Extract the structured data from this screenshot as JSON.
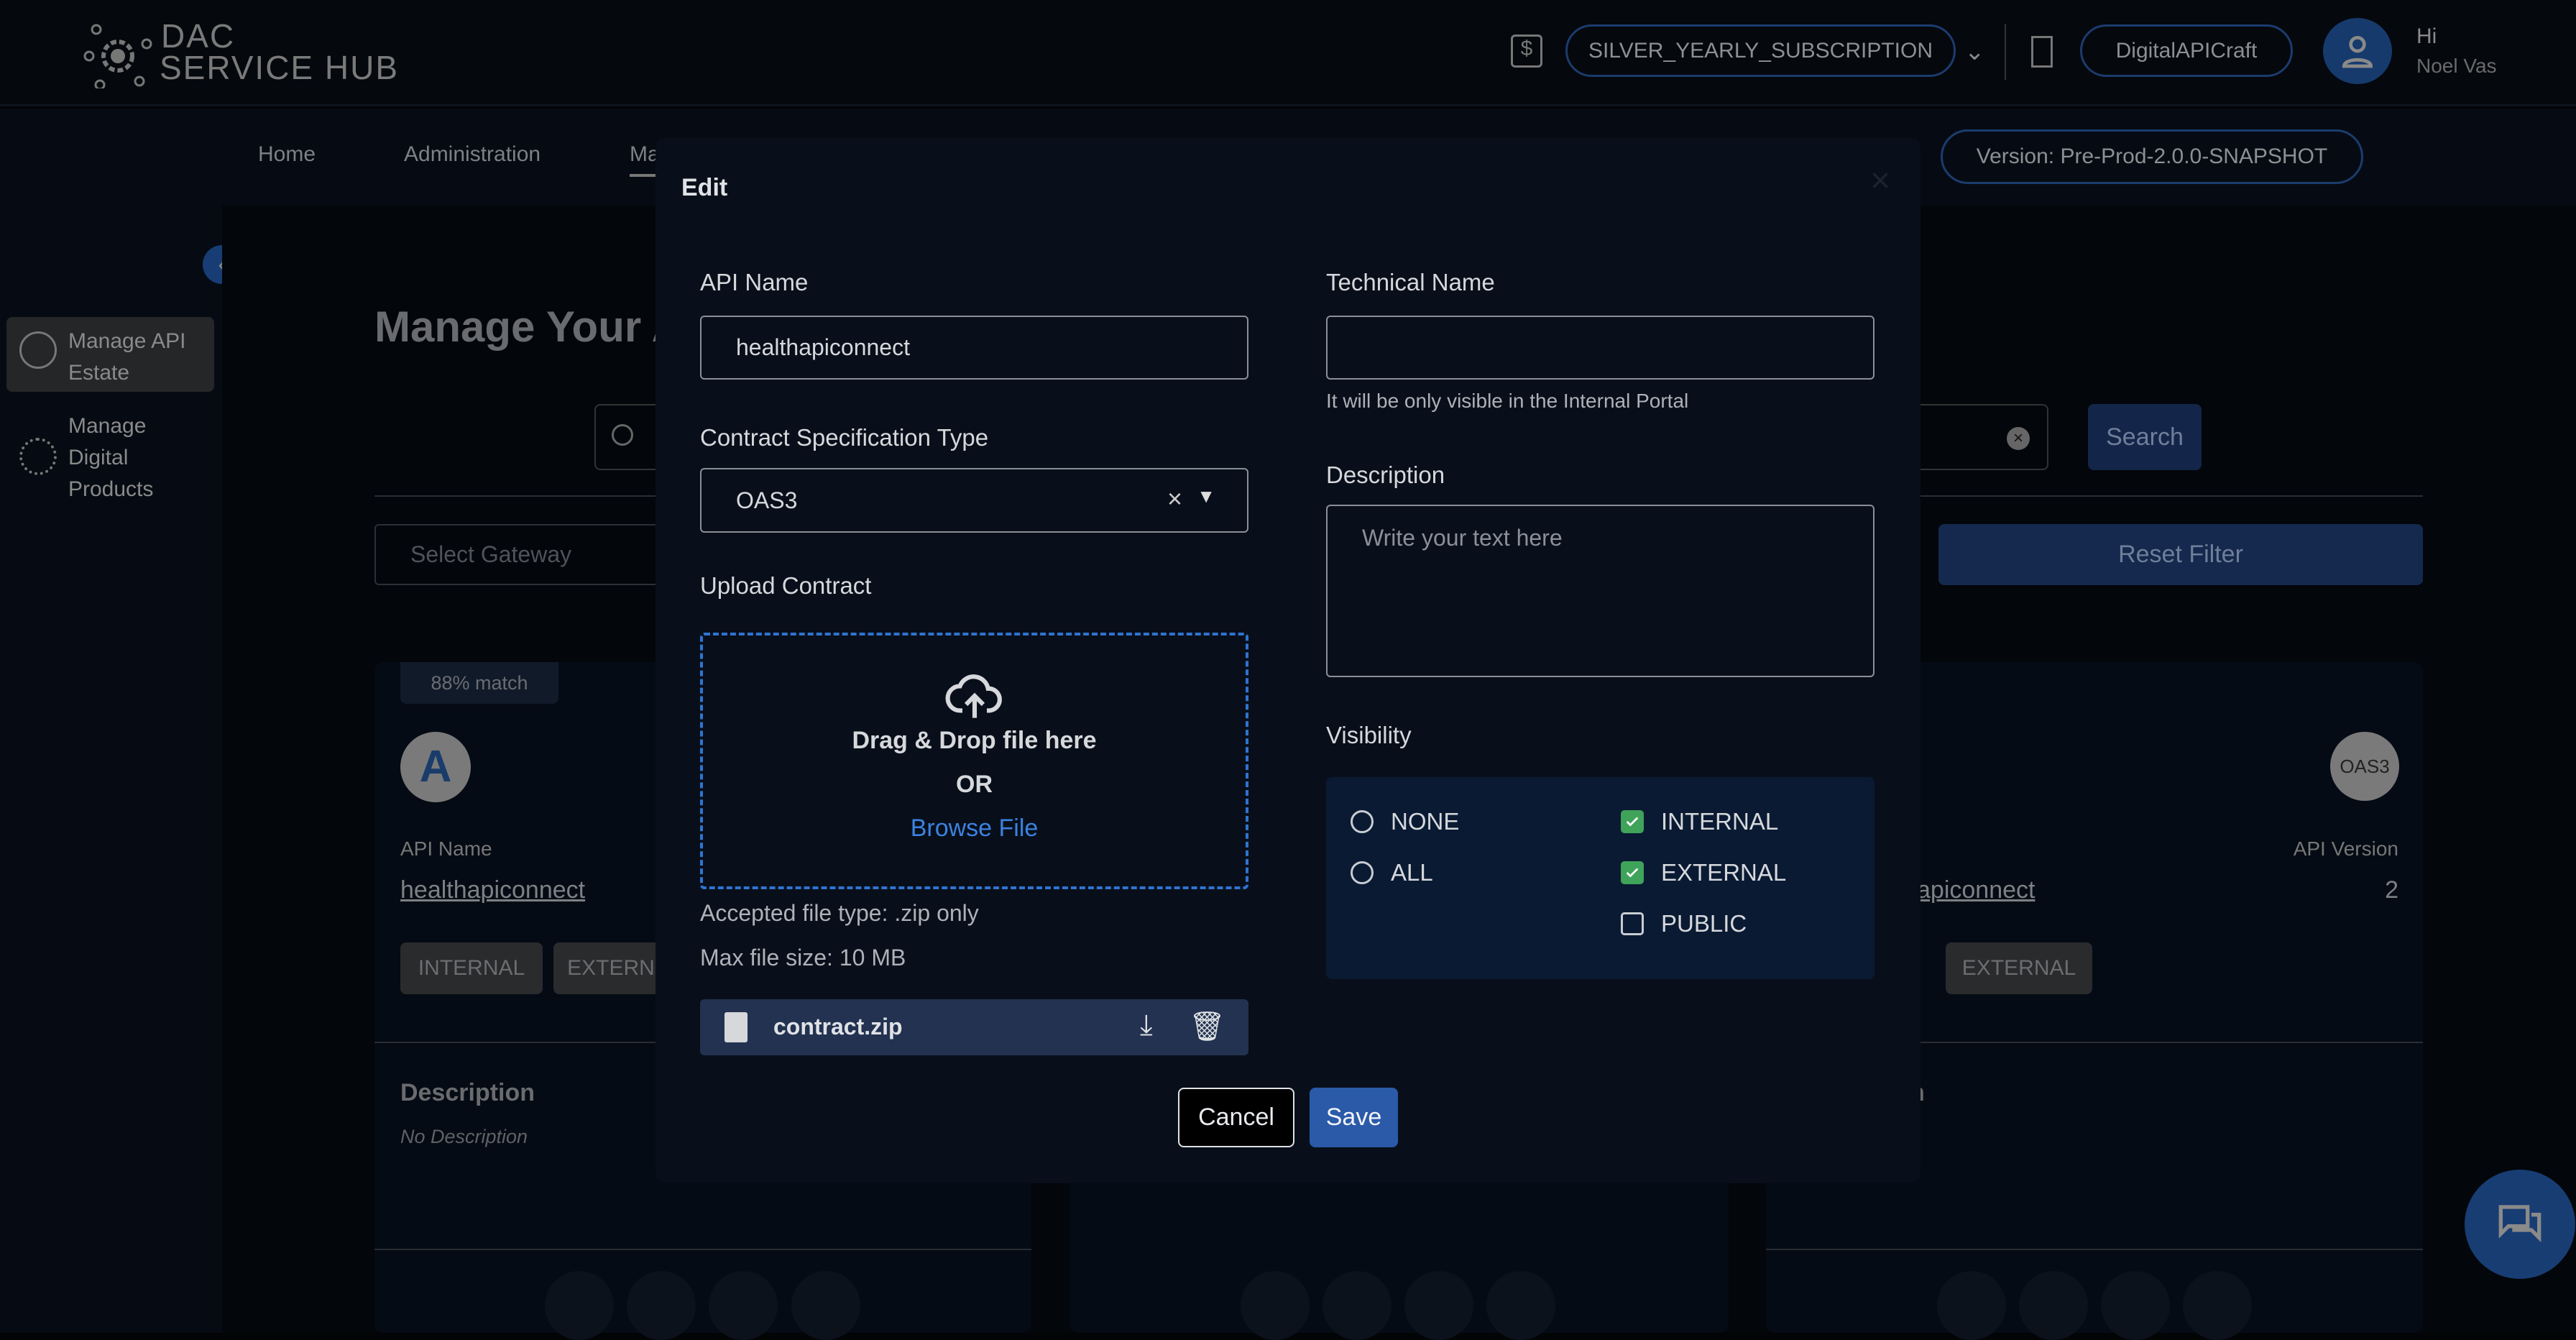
{
  "header": {
    "logo_line1": "DAC",
    "logo_line2": "SERVICE HUB",
    "subscription": "SILVER_YEARLY_SUBSCRIPTION",
    "organization": "DigitalAPICraft",
    "greeting": "Hi",
    "user_name": "Noel Vas"
  },
  "nav": {
    "items": [
      "Home",
      "Administration",
      "Ma"
    ],
    "version": "Version: Pre-Prod-2.0.0-SNAPSHOT"
  },
  "sidebar": {
    "items": [
      {
        "label": "Manage API Estate",
        "icon": "cloud-upload-icon",
        "active": true
      },
      {
        "label": "Manage Digital Products",
        "icon": "gear-box-icon",
        "active": false
      }
    ]
  },
  "main": {
    "title": "Manage Your A",
    "search_button": "Search",
    "gateway_placeholder": "Select Gateway",
    "reset_filter": "Reset Filter",
    "cards": [
      {
        "match": "88% match",
        "api_name_label": "API Name",
        "api_name": "healthapiconnect",
        "tags": [
          "INTERNAL",
          "EXTERN"
        ],
        "description_label": "Description",
        "description": "No Description"
      },
      {
        "badge": "OAS3",
        "api_name": "apiconnect",
        "api_version_label": "API Version",
        "api_version": "2",
        "tags": [
          "EXTERNAL"
        ],
        "description_label": "n"
      }
    ]
  },
  "modal": {
    "title": "Edit",
    "api_name_label": "API Name",
    "api_name_value": "healthapiconnect",
    "spec_type_label": "Contract Specification Type",
    "spec_type_value": "OAS3",
    "upload_label": "Upload Contract",
    "drop_text": "Drag & Drop file here",
    "or_text": "OR",
    "browse": "Browse File",
    "accepted": "Accepted file type: .zip only",
    "max_size": "Max file size: 10 MB",
    "file_name": "contract.zip",
    "tech_name_label": "Technical Name",
    "tech_name_value": "",
    "tech_name_hint": "It will be only visible in the Internal Portal",
    "description_label": "Description",
    "description_placeholder": "Write your text here",
    "visibility_label": "Visibility",
    "visibility": [
      {
        "label": "NONE",
        "type": "radio",
        "checked": false
      },
      {
        "label": "ALL",
        "type": "radio",
        "checked": false
      },
      {
        "label": "INTERNAL",
        "type": "checkbox",
        "checked": true
      },
      {
        "label": "EXTERNAL",
        "type": "checkbox",
        "checked": true
      },
      {
        "label": "PUBLIC",
        "type": "checkbox",
        "checked": false
      }
    ],
    "cancel": "Cancel",
    "save": "Save"
  },
  "colors": {
    "accent": "#2a5aa8",
    "browse": "#3b82e0",
    "checkbox": "#3fa35a"
  }
}
